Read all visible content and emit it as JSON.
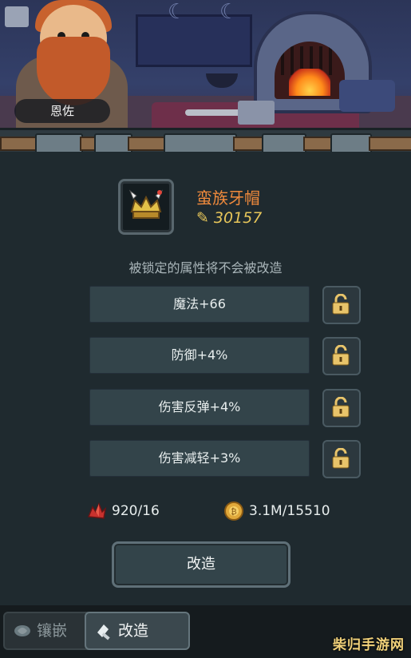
{
  "npc": {
    "name": "恩佐"
  },
  "item": {
    "name": "蛮族牙帽",
    "power": "30157",
    "power_icon": "power-icon"
  },
  "hint": "被锁定的属性将不会被改造",
  "attributes": [
    {
      "label": "魔法+66",
      "locked": false
    },
    {
      "label": "防御+4%",
      "locked": false
    },
    {
      "label": "伤害反弹+4%",
      "locked": false
    },
    {
      "label": "伤害减轻+3%",
      "locked": false
    }
  ],
  "resources": {
    "crystal": {
      "value": "920/16",
      "icon": "red-crystal-icon"
    },
    "gold": {
      "value": "3.1M/15510",
      "icon": "gold-coin-icon"
    }
  },
  "action_button": "改造",
  "tabs": [
    {
      "label": "镶嵌",
      "icon": "gem-icon",
      "active": false
    },
    {
      "label": "改造",
      "icon": "hammer-icon",
      "active": true
    }
  ],
  "watermark": "柴归手游网",
  "colors": {
    "item_name": "#f08a3c",
    "power": "#e7c65a",
    "lock": "#e8c46a"
  }
}
